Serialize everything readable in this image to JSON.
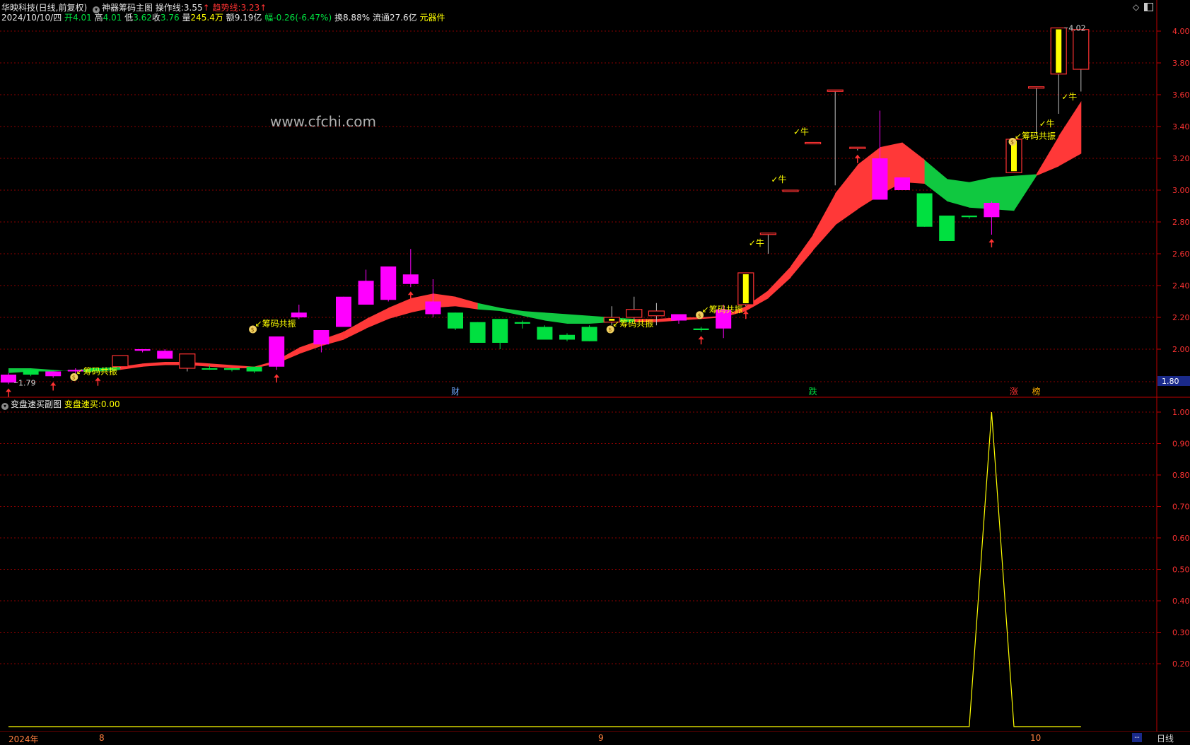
{
  "header": {
    "stock": "华映科技(日线,前复权)",
    "indicator_name": "神器筹码主图",
    "op_line_label": "操作线:",
    "op_line_value": "3.55",
    "trend_line_label": "趋势线:",
    "trend_line_value": "3.23",
    "arrow_up": "↑",
    "date": "2024/10/10/四",
    "open_label": "开",
    "open": "4.01",
    "high_label": "高",
    "high": "4.01",
    "low_label": "低",
    "low": "3.62",
    "close_label": "收",
    "close": "3.76",
    "vol_label": "量",
    "vol": "245.4万",
    "amt_label": "额",
    "amt": "9.19亿",
    "chg_label": "幅",
    "chg": "-0.26(-6.47%)",
    "turnover_label": "换",
    "turnover": "8.88%",
    "float_label": "流通",
    "float": "27.6亿",
    "sector": "元器件"
  },
  "sub_header": {
    "indicator_name": "变盘速买副图",
    "label": "变盘速买:",
    "value": "0.00"
  },
  "watermark": "www.cfchi.com",
  "bottom_bar": {
    "period": "日线",
    "dash": "--",
    "time_labels": [
      "2024年",
      "8",
      "9",
      "10"
    ]
  },
  "icons": [
    "diamond-icon",
    "window-icon",
    "collapse-circle-icon"
  ],
  "colors": {
    "up": "#ff3232",
    "down": "#00e040",
    "magenta": "#ff00ff",
    "yellow": "#ffff00",
    "band_red": "#ff3838",
    "band_green": "#10c840",
    "grid": "#8b0000",
    "axis": "#c00000"
  },
  "chart_data": [
    {
      "type": "candlestick",
      "title": "神器筹码主图",
      "ylim": [
        1.7,
        4.1
      ],
      "y_ticks": [
        "1.80",
        "2.00",
        "2.20",
        "2.40",
        "2.60",
        "2.80",
        "3.00",
        "3.20",
        "3.40",
        "3.60",
        "3.80",
        "4.00"
      ],
      "current_price_marker": "1.80",
      "candles": [
        {
          "o": 1.84,
          "c": 1.79,
          "h": 1.85,
          "l": 1.78,
          "s": "m"
        },
        {
          "o": 1.84,
          "c": 1.87,
          "h": 1.88,
          "l": 1.83,
          "s": "g"
        },
        {
          "o": 1.83,
          "c": 1.86,
          "h": 1.86,
          "l": 1.82,
          "s": "m"
        },
        {
          "o": 1.87,
          "c": 1.86,
          "h": 1.88,
          "l": 1.84,
          "s": "m"
        },
        {
          "o": 1.88,
          "c": 1.87,
          "h": 1.88,
          "l": 1.85,
          "s": "g"
        },
        {
          "o": 1.89,
          "c": 1.96,
          "h": 1.96,
          "l": 1.88,
          "s": "r"
        },
        {
          "o": 1.99,
          "c": 2.0,
          "h": 2.0,
          "l": 1.98,
          "s": "m"
        },
        {
          "o": 1.94,
          "c": 1.99,
          "h": 2.0,
          "l": 1.94,
          "s": "m"
        },
        {
          "o": 1.88,
          "c": 1.97,
          "h": 1.97,
          "l": 1.86,
          "s": "r"
        },
        {
          "o": 1.88,
          "c": 1.88,
          "h": 1.9,
          "l": 1.87,
          "s": "g"
        },
        {
          "o": 1.87,
          "c": 1.88,
          "h": 1.88,
          "l": 1.86,
          "s": "g"
        },
        {
          "o": 1.86,
          "c": 1.89,
          "h": 1.89,
          "l": 1.85,
          "s": "g"
        },
        {
          "o": 1.89,
          "c": 2.08,
          "h": 2.08,
          "l": 1.87,
          "s": "m"
        },
        {
          "o": 2.2,
          "c": 2.23,
          "h": 2.28,
          "l": 2.19,
          "s": "m"
        },
        {
          "o": 2.03,
          "c": 2.12,
          "h": 2.12,
          "l": 1.98,
          "s": "m"
        },
        {
          "o": 2.14,
          "c": 2.33,
          "h": 2.33,
          "l": 2.14,
          "s": "m"
        },
        {
          "o": 2.28,
          "c": 2.43,
          "h": 2.5,
          "l": 2.28,
          "s": "m"
        },
        {
          "o": 2.31,
          "c": 2.52,
          "h": 2.52,
          "l": 2.3,
          "s": "m"
        },
        {
          "o": 2.41,
          "c": 2.47,
          "h": 2.63,
          "l": 2.39,
          "s": "m"
        },
        {
          "o": 2.22,
          "c": 2.3,
          "h": 2.44,
          "l": 2.2,
          "s": "m"
        },
        {
          "o": 2.23,
          "c": 2.13,
          "h": 2.23,
          "l": 2.12,
          "s": "g"
        },
        {
          "o": 2.17,
          "c": 2.04,
          "h": 2.17,
          "l": 2.04,
          "s": "g"
        },
        {
          "o": 2.19,
          "c": 2.04,
          "h": 2.19,
          "l": 2.0,
          "s": "g"
        },
        {
          "o": 2.17,
          "c": 2.16,
          "h": 2.18,
          "l": 2.13,
          "s": "g"
        },
        {
          "o": 2.14,
          "c": 2.06,
          "h": 2.15,
          "l": 2.06,
          "s": "g"
        },
        {
          "o": 2.09,
          "c": 2.06,
          "h": 2.1,
          "l": 2.05,
          "s": "g"
        },
        {
          "o": 2.14,
          "c": 2.05,
          "h": 2.15,
          "l": 2.05,
          "s": "g"
        },
        {
          "o": 2.17,
          "c": 2.2,
          "h": 2.27,
          "l": 2.15,
          "s": "y"
        },
        {
          "o": 2.2,
          "c": 2.25,
          "h": 2.33,
          "l": 2.19,
          "s": "r"
        },
        {
          "o": 2.21,
          "c": 2.24,
          "h": 2.29,
          "l": 2.15,
          "s": "r"
        },
        {
          "o": 2.18,
          "c": 2.22,
          "h": 2.22,
          "l": 2.16,
          "s": "m"
        },
        {
          "o": 2.13,
          "c": 2.12,
          "h": 2.14,
          "l": 2.11,
          "s": "g"
        },
        {
          "o": 2.13,
          "c": 2.25,
          "h": 2.28,
          "l": 2.07,
          "s": "m"
        },
        {
          "o": 2.28,
          "c": 2.48,
          "h": 2.48,
          "l": 2.27,
          "s": "y"
        },
        {
          "o": 2.73,
          "c": 2.73,
          "h": 2.73,
          "l": 2.6,
          "s": "r"
        },
        {
          "o": 3.0,
          "c": 3.0,
          "h": 3.0,
          "l": 2.99,
          "s": "r"
        },
        {
          "o": 3.3,
          "c": 3.3,
          "h": 3.3,
          "l": 3.3,
          "s": "r"
        },
        {
          "o": 3.63,
          "c": 3.63,
          "h": 3.63,
          "l": 3.03,
          "s": "r"
        },
        {
          "o": 3.27,
          "c": 3.27,
          "h": 3.27,
          "l": 3.25,
          "s": "r"
        },
        {
          "o": 3.2,
          "c": 2.94,
          "h": 3.5,
          "l": 2.94,
          "s": "m"
        },
        {
          "o": 3.08,
          "c": 3.0,
          "h": 3.08,
          "l": 3.0,
          "s": "m"
        },
        {
          "o": 2.98,
          "c": 2.77,
          "h": 2.98,
          "l": 2.77,
          "s": "g"
        },
        {
          "o": 2.84,
          "c": 2.68,
          "h": 2.84,
          "l": 2.68,
          "s": "g"
        },
        {
          "o": 2.84,
          "c": 2.83,
          "h": 2.84,
          "l": 2.82,
          "s": "g"
        },
        {
          "o": 2.83,
          "c": 2.92,
          "h": 2.93,
          "l": 2.72,
          "s": "m"
        },
        {
          "o": 3.11,
          "c": 3.32,
          "h": 3.32,
          "l": 3.11,
          "s": "y"
        },
        {
          "o": 3.65,
          "c": 3.65,
          "h": 3.65,
          "l": 3.35,
          "s": "r"
        },
        {
          "o": 3.73,
          "c": 4.02,
          "h": 4.02,
          "l": 3.48,
          "s": "y"
        },
        {
          "o": 4.01,
          "c": 3.76,
          "h": 4.01,
          "l": 3.62,
          "s": "r"
        }
      ],
      "band_upper": [
        1.85,
        1.86,
        1.86,
        1.87,
        1.88,
        1.89,
        1.91,
        1.92,
        1.92,
        1.91,
        1.9,
        1.89,
        1.93,
        2.01,
        2.06,
        2.11,
        2.19,
        2.26,
        2.32,
        2.35,
        2.33,
        2.29,
        2.26,
        2.24,
        2.23,
        2.22,
        2.21,
        2.2,
        2.19,
        2.19,
        2.2,
        2.2,
        2.21,
        2.27,
        2.37,
        2.52,
        2.72,
        2.98,
        3.16,
        3.27,
        3.3,
        3.19,
        3.07,
        3.05,
        3.08,
        3.09,
        3.1,
        3.34,
        3.56
      ],
      "band_lower": [
        1.88,
        1.88,
        1.87,
        1.86,
        1.86,
        1.87,
        1.89,
        1.9,
        1.9,
        1.89,
        1.88,
        1.88,
        1.91,
        1.97,
        2.02,
        2.06,
        2.13,
        2.19,
        2.23,
        2.26,
        2.27,
        2.25,
        2.24,
        2.21,
        2.18,
        2.16,
        2.16,
        2.17,
        2.17,
        2.17,
        2.18,
        2.19,
        2.2,
        2.24,
        2.32,
        2.45,
        2.62,
        2.78,
        2.88,
        2.97,
        3.05,
        3.04,
        2.93,
        2.89,
        2.88,
        2.87,
        3.09,
        3.15,
        3.23
      ],
      "band_colors": [
        "g",
        "g",
        "g",
        "g",
        "g",
        "r",
        "r",
        "r",
        "r",
        "r",
        "r",
        "r",
        "r",
        "r",
        "r",
        "r",
        "r",
        "r",
        "r",
        "r",
        "r",
        "g",
        "g",
        "g",
        "g",
        "g",
        "g",
        "g",
        "r",
        "r",
        "r",
        "r",
        "r",
        "r",
        "r",
        "r",
        "r",
        "r",
        "r",
        "r",
        "r",
        "g",
        "g",
        "g",
        "g",
        "g",
        "r",
        "r",
        "r"
      ],
      "red_up_arrows": [
        0,
        2,
        4,
        12,
        15,
        18,
        31,
        33,
        38,
        44
      ],
      "resonance_labels": [
        {
          "i": 3,
          "y": 1.86,
          "text": "筹码共振"
        },
        {
          "i": 11,
          "y": 2.16,
          "text": "筹码共振"
        },
        {
          "i": 27,
          "y": 2.16,
          "text": "筹码共振"
        },
        {
          "i": 31,
          "y": 2.25,
          "text": "筹码共振"
        },
        {
          "i": 45,
          "y": 3.34,
          "text": "筹码共振"
        }
      ],
      "bull_labels": [
        {
          "i": 33,
          "y": 2.65,
          "text": "牛"
        },
        {
          "i": 34,
          "y": 3.05,
          "text": "牛"
        },
        {
          "i": 35,
          "y": 3.35,
          "text": "牛"
        },
        {
          "i": 46,
          "y": 3.4,
          "text": "牛"
        },
        {
          "i": 47,
          "y": 3.57,
          "text": "牛"
        }
      ],
      "price_labels": [
        {
          "text": "1.79",
          "i": 0,
          "y": 1.79
        },
        {
          "text": "4.02",
          "i": 47,
          "y": 4.02
        }
      ],
      "event_tags": [
        {
          "i": 20,
          "text": "财",
          "color": "#6fa8ff"
        },
        {
          "i": 36,
          "text": "跌",
          "color": "#00e040"
        },
        {
          "i": 45,
          "text": "涨",
          "color": "#ff3232"
        },
        {
          "i": 46,
          "text": "榜",
          "color": "#ffb000"
        }
      ]
    },
    {
      "type": "line",
      "title": "变盘速买副图",
      "ylim": [
        0,
        1.05
      ],
      "y_ticks": [
        "0.20",
        "0.30",
        "0.40",
        "0.50",
        "0.60",
        "0.70",
        "0.80",
        "0.90",
        "1.00"
      ],
      "series": [
        {
          "name": "变盘速买",
          "color": "#ffff00",
          "values": [
            0,
            0,
            0,
            0,
            0,
            0,
            0,
            0,
            0,
            0,
            0,
            0,
            0,
            0,
            0,
            0,
            0,
            0,
            0,
            0,
            0,
            0,
            0,
            0,
            0,
            0,
            0,
            0,
            0,
            0,
            0,
            0,
            0,
            0,
            0,
            0,
            0,
            0,
            0,
            0,
            0,
            0,
            0,
            0,
            1,
            0,
            0,
            0,
            0
          ]
        }
      ]
    }
  ]
}
